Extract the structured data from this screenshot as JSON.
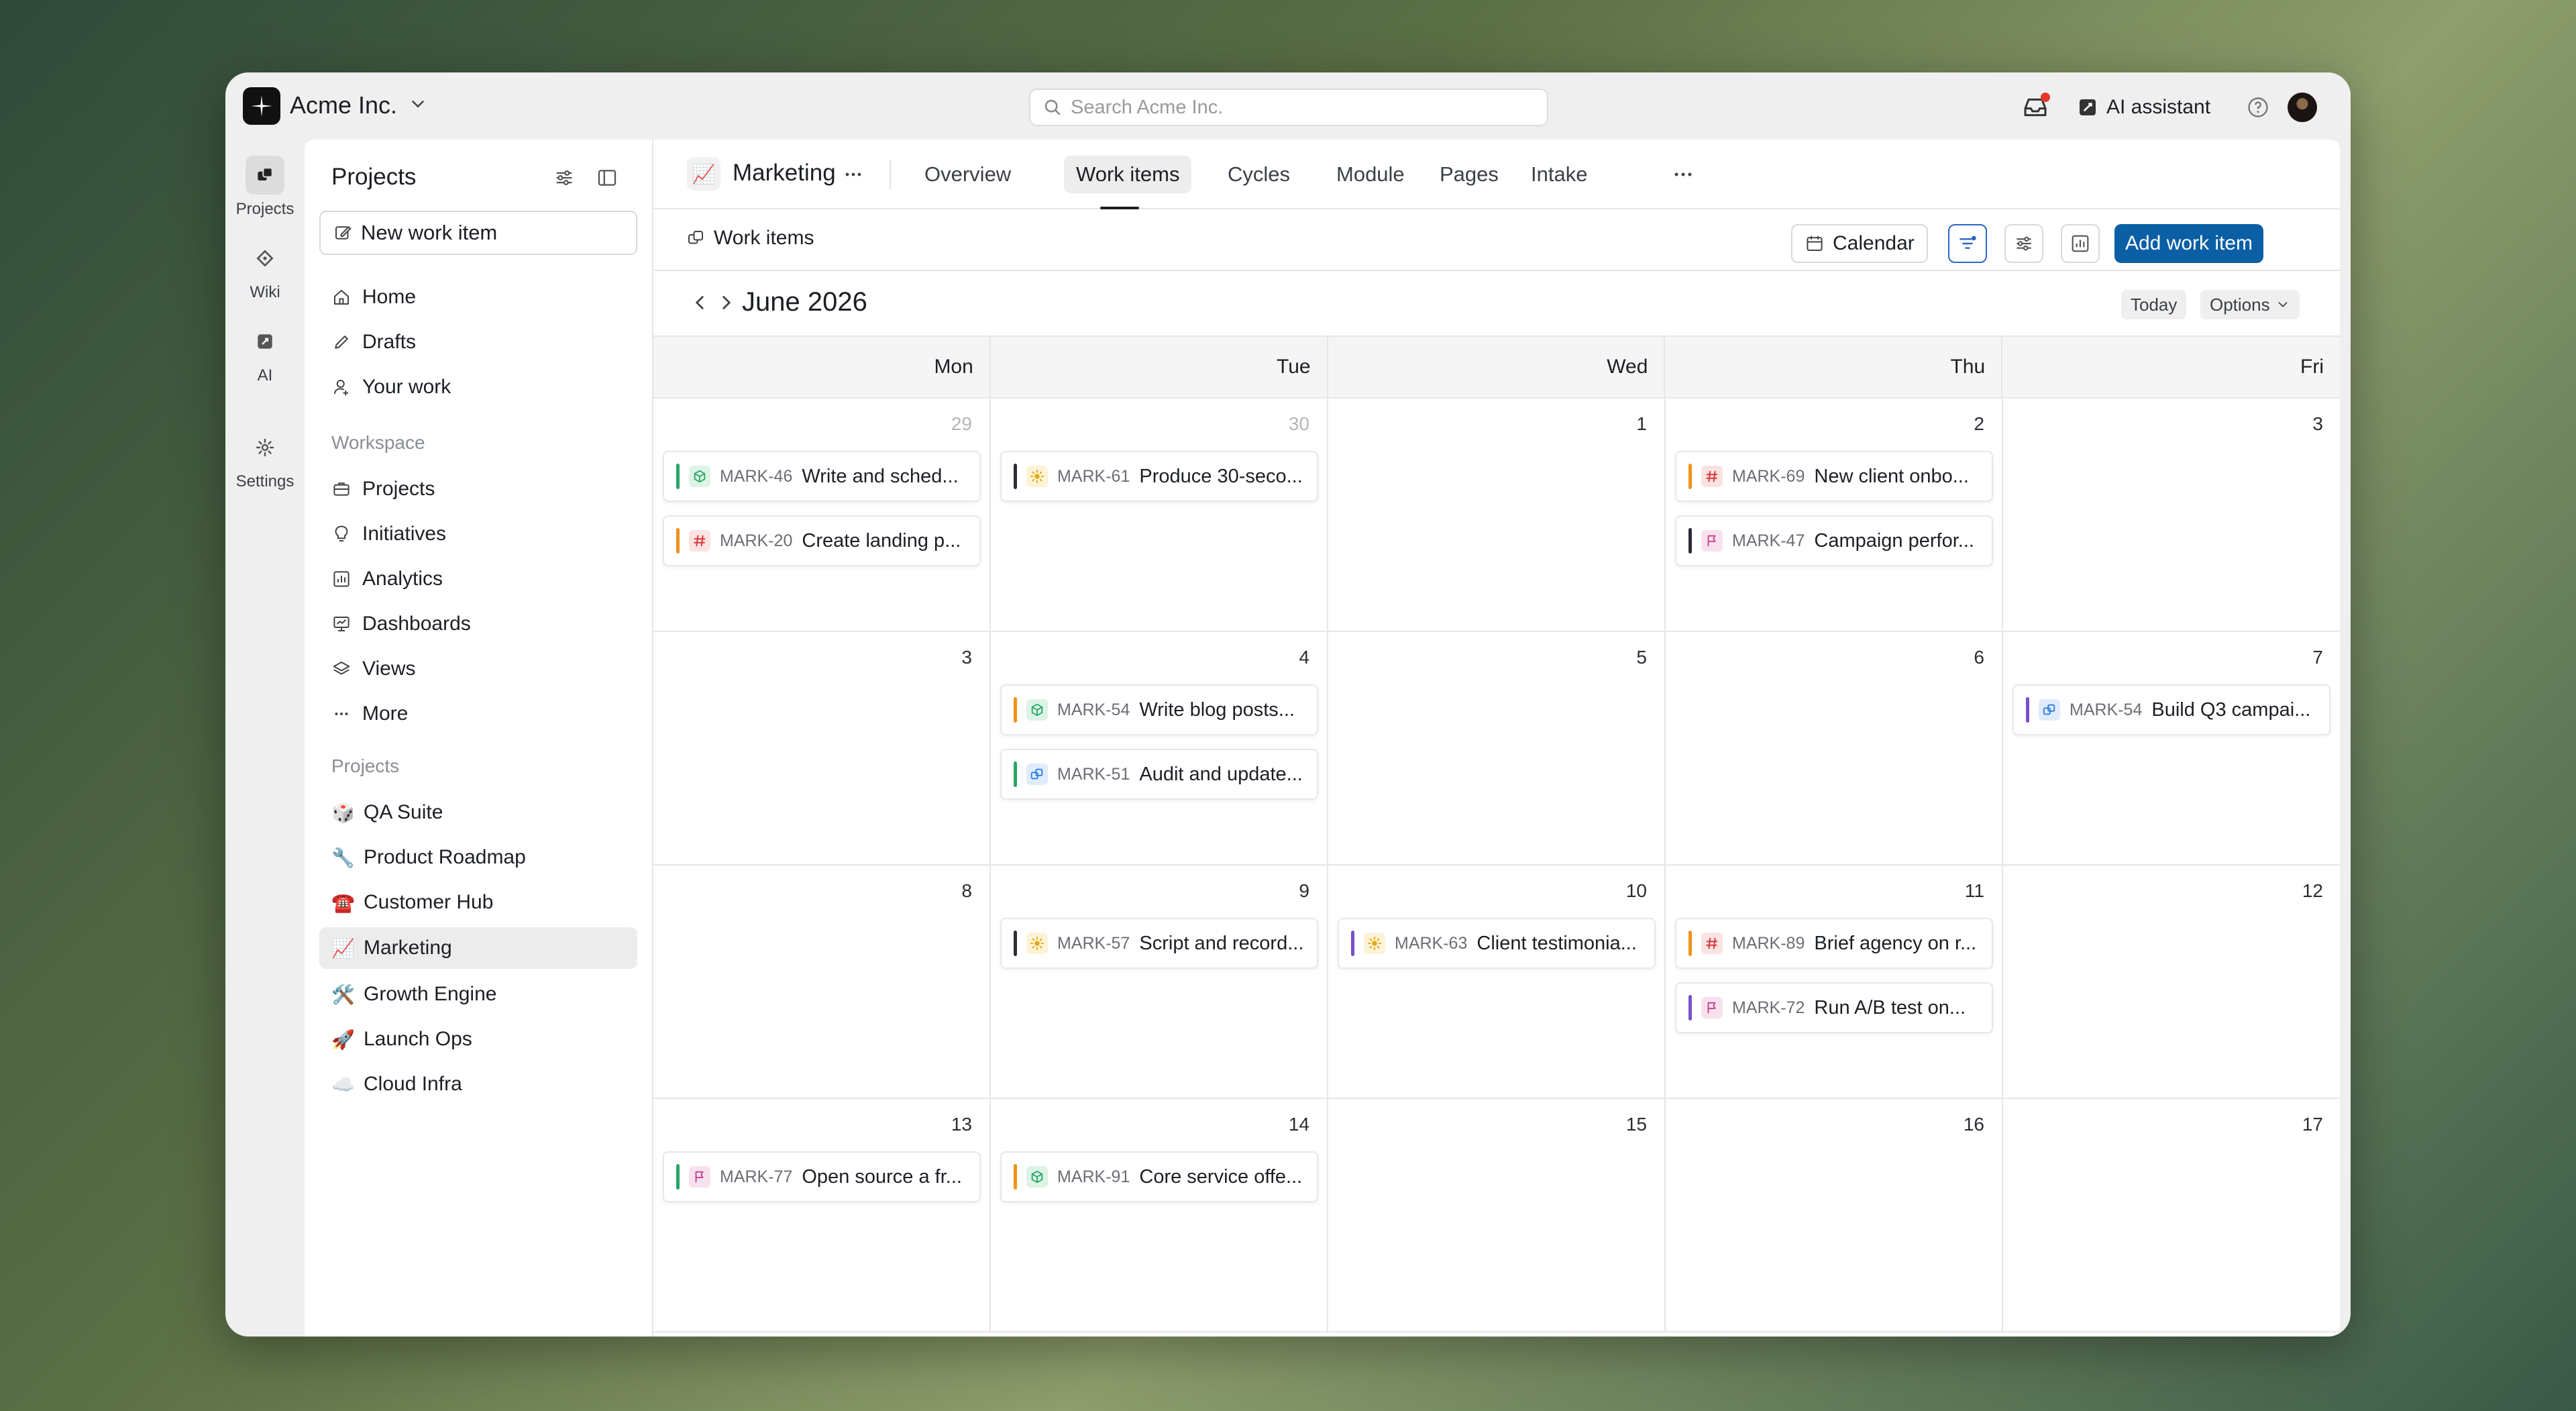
{
  "workspace": {
    "name": "Acme Inc."
  },
  "search": {
    "placeholder": "Search Acme Inc."
  },
  "topbar": {
    "ai_label": "AI assistant"
  },
  "rail": [
    {
      "label": "Projects",
      "icon": "projects-icon"
    },
    {
      "label": "Wiki",
      "icon": "wiki-icon"
    },
    {
      "label": "AI",
      "icon": "ai-icon"
    },
    {
      "label": "Settings",
      "icon": "gear-icon"
    }
  ],
  "sidebar": {
    "title": "Projects",
    "new_item": "New work item",
    "nav": [
      "Home",
      "Drafts",
      "Your work"
    ],
    "workspace_label": "Workspace",
    "workspace_items": [
      "Projects",
      "Initiatives",
      "Analytics",
      "Dashboards",
      "Views",
      "More"
    ],
    "projects_label": "Projects",
    "projects": [
      {
        "emoji": "🎲",
        "name": "QA Suite"
      },
      {
        "emoji": "🔧",
        "name": "Product Roadmap"
      },
      {
        "emoji": "☎️",
        "name": "Customer Hub"
      },
      {
        "emoji": "📈",
        "name": "Marketing"
      },
      {
        "emoji": "🛠️",
        "name": "Growth Engine"
      },
      {
        "emoji": "🚀",
        "name": "Launch Ops"
      },
      {
        "emoji": "☁️",
        "name": "Cloud Infra"
      }
    ]
  },
  "header": {
    "project_emoji": "📈",
    "project_name": "Marketing",
    "tabs": [
      "Overview",
      "Work items",
      "Cycles",
      "Module",
      "Pages",
      "Intake"
    ]
  },
  "toolbar": {
    "work_items_label": "Work items",
    "layout_label": "Calendar",
    "add_label": "Add work item"
  },
  "calendar": {
    "month": "June 2026",
    "today_label": "Today",
    "options_label": "Options",
    "weekdays": [
      "Mon",
      "Tue",
      "Wed",
      "Thu",
      "Fri"
    ],
    "weeks": [
      [
        {
          "day": "29",
          "muted": true,
          "items": [
            {
              "key": "MARK-46",
              "title": "Write and sched...",
              "bar": "#27a567",
              "icon": "cube",
              "icon_color": "#27a567",
              "icon_bg": "#ddf3e6"
            },
            {
              "key": "MARK-20",
              "title": "Create landing p...",
              "bar": "#f0921a",
              "icon": "hash",
              "icon_color": "#d6383a",
              "icon_bg": "#fbe3e3"
            }
          ]
        },
        {
          "day": "30",
          "muted": true,
          "items": [
            {
              "key": "MARK-61",
              "title": "Produce 30-seco...",
              "bar": "#2a2d33",
              "icon": "sun",
              "icon_color": "#e5a50a",
              "icon_bg": "#fdf3d6"
            }
          ]
        },
        {
          "day": "1",
          "muted": false,
          "items": []
        },
        {
          "day": "2",
          "muted": false,
          "items": [
            {
              "key": "MARK-69",
              "title": "New client onbo...",
              "bar": "#f0921a",
              "icon": "hash",
              "icon_color": "#d6383a",
              "icon_bg": "#fbe3e3"
            },
            {
              "key": "MARK-47",
              "title": "Campaign perfor...",
              "bar": "#2a2d33",
              "icon": "flag",
              "icon_color": "#c2408e",
              "icon_bg": "#f8e1ee"
            }
          ]
        },
        {
          "day": "3",
          "muted": false,
          "items": []
        }
      ],
      [
        {
          "day": "3",
          "muted": false,
          "items": []
        },
        {
          "day": "4",
          "muted": false,
          "items": [
            {
              "key": "MARK-54",
              "title": "Write blog posts...",
              "bar": "#f0921a",
              "icon": "cube",
              "icon_color": "#27a567",
              "icon_bg": "#ddf3e6"
            },
            {
              "key": "MARK-51",
              "title": "Audit and update...",
              "bar": "#27a567",
              "icon": "cubes",
              "icon_color": "#2a7de1",
              "icon_bg": "#e0ecfb"
            }
          ]
        },
        {
          "day": "5",
          "muted": false,
          "items": []
        },
        {
          "day": "6",
          "muted": false,
          "items": []
        },
        {
          "day": "7",
          "muted": false,
          "items": [
            {
              "key": "MARK-54",
              "title": "Build Q3 campai...",
              "bar": "#7a4fcf",
              "icon": "cubes",
              "icon_color": "#2a7de1",
              "icon_bg": "#e0ecfb"
            }
          ]
        }
      ],
      [
        {
          "day": "8",
          "muted": false,
          "items": []
        },
        {
          "day": "9",
          "muted": false,
          "items": [
            {
              "key": "MARK-57",
              "title": "Script and record...",
              "bar": "#2a2d33",
              "icon": "sun",
              "icon_color": "#e5a50a",
              "icon_bg": "#fdf3d6"
            }
          ]
        },
        {
          "day": "10",
          "muted": false,
          "items": [
            {
              "key": "MARK-63",
              "title": "Client testimonia...",
              "bar": "#7a4fcf",
              "icon": "sun",
              "icon_color": "#e5a50a",
              "icon_bg": "#fdf3d6"
            }
          ]
        },
        {
          "day": "11",
          "muted": false,
          "items": [
            {
              "key": "MARK-89",
              "title": "Brief agency on r...",
              "bar": "#f0921a",
              "icon": "hash",
              "icon_color": "#d6383a",
              "icon_bg": "#fbe3e3"
            },
            {
              "key": "MARK-72",
              "title": "Run A/B test on...",
              "bar": "#7a4fcf",
              "icon": "flag",
              "icon_color": "#c2408e",
              "icon_bg": "#f8e1ee"
            }
          ]
        },
        {
          "day": "12",
          "muted": false,
          "items": []
        }
      ],
      [
        {
          "day": "13",
          "muted": false,
          "items": [
            {
              "key": "MARK-77",
              "title": "Open source a fr...",
              "bar": "#27a567",
              "icon": "flag",
              "icon_color": "#c2408e",
              "icon_bg": "#f8e1ee"
            }
          ]
        },
        {
          "day": "14",
          "muted": false,
          "items": [
            {
              "key": "MARK-91",
              "title": "Core service offe...",
              "bar": "#f0921a",
              "icon": "cube",
              "icon_color": "#27a567",
              "icon_bg": "#ddf3e6"
            }
          ]
        },
        {
          "day": "15",
          "muted": false,
          "items": []
        },
        {
          "day": "16",
          "muted": false,
          "items": []
        },
        {
          "day": "17",
          "muted": false,
          "items": []
        }
      ]
    ]
  }
}
